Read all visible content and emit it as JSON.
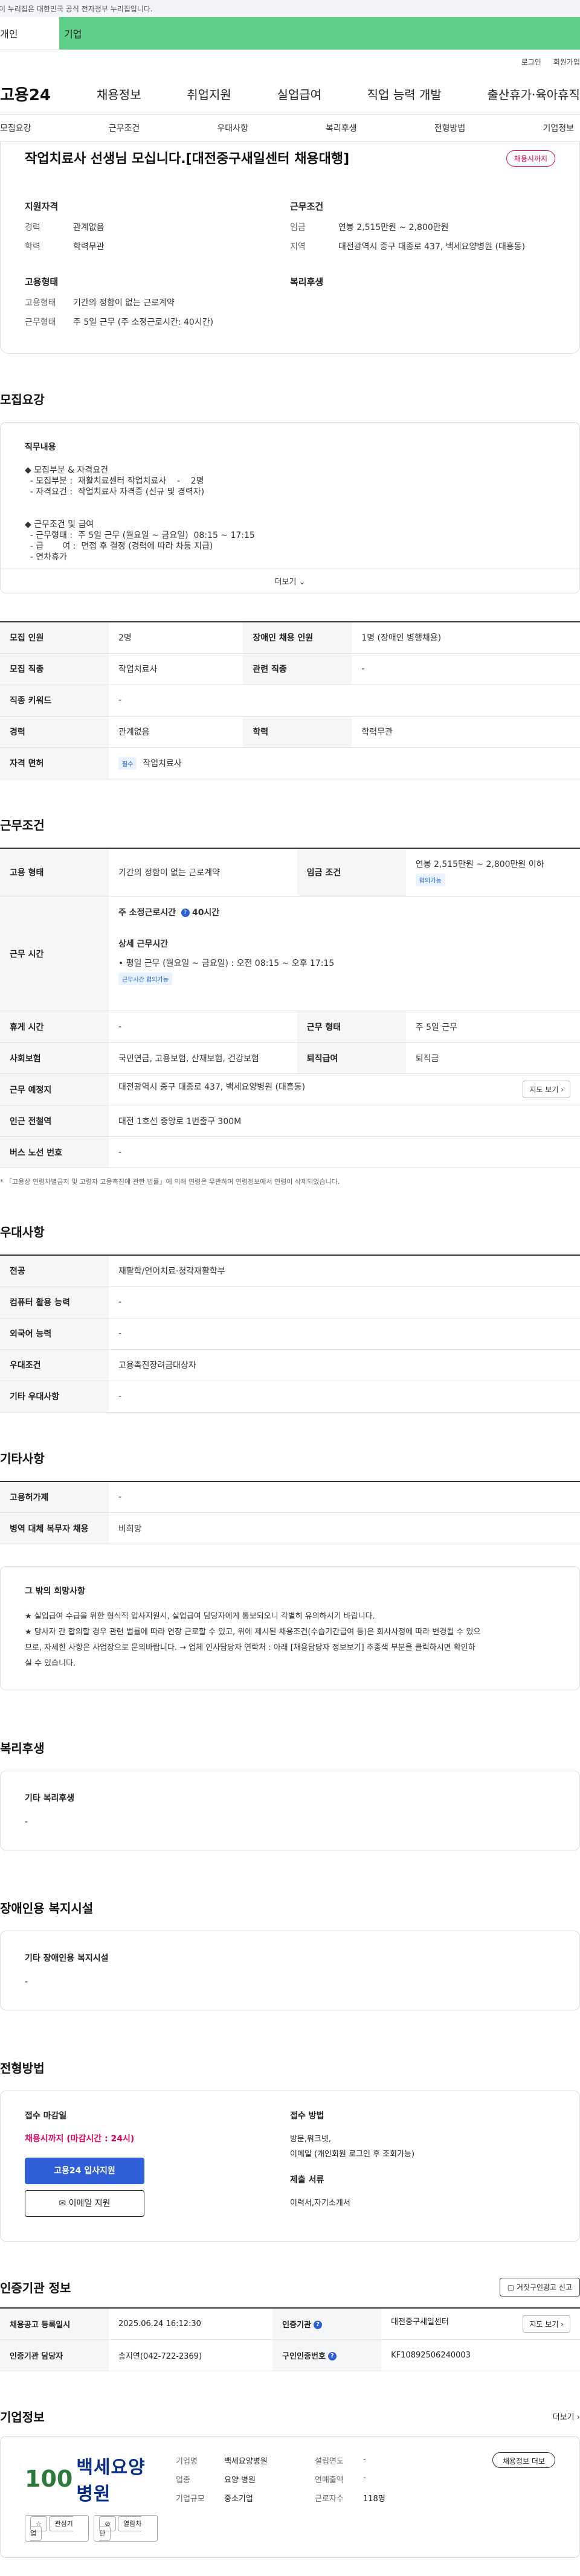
{
  "gov_banner": "이 누리집은 대한민국 공식 전자정부 누리집입니다.",
  "service_tabs": {
    "left": "개인",
    "active": "기업"
  },
  "util_links": [
    "로그인",
    "회원가입"
  ],
  "gnb": {
    "logo": "고용24",
    "menu": [
      "채용정보",
      "취업지원",
      "실업급여",
      "직업 능력 개발",
      "출산휴가·육아휴직"
    ]
  },
  "subnav": [
    "모집요강",
    "근무조건",
    "우대사항",
    "복리후생",
    "전형방법",
    "기업정보"
  ],
  "summary": {
    "title": "작업치료사 선생님 모십니다.[대전중구새일센터 채용대행]",
    "status": "채용시까지",
    "qualification": {
      "heading": "지원자격",
      "career_label": "경력",
      "career_value": "관계없음",
      "edu_label": "학력",
      "edu_value": "학력무관"
    },
    "work": {
      "heading": "근무조건",
      "pay_label": "임금",
      "pay_value": "연봉 2,515만원 ~ 2,800만원",
      "location_label": "지역",
      "location_value": "대전광역시 중구 대종로 437, 백세요양병원 (대흥동)"
    },
    "employment": {
      "heading": "고용형태",
      "type_label": "고용형태",
      "type_value": "기간의 정함이 없는 근로계약",
      "hours_label": "근무형태",
      "hours_value": "주 5일 근무 (주 소정근로시간: 40시간)"
    },
    "welfare": {
      "heading": "복리후생"
    }
  },
  "recruit": {
    "section_title": "모집요강",
    "duty_heading": "직무내용",
    "duty_lines": [
      "◆ 모집부분 & 자격요건",
      "  - 모집부분 :  재활치료센터 작업치료사    -    2명",
      "  - 자격요건 :  작업치료사 자격증 (신규 및 경력자)",
      "",
      "",
      "◆ 근무조건 및 급여",
      "  - 근무형태 :  주 5일 근무 (월요일 ~ 금요일)  08:15 ~ 17:15",
      "  - 급       여 :  면접 후 결정 (경력에 따라 차등 지급)",
      "  - 연차휴가"
    ],
    "more": "더보기",
    "rows": [
      {
        "k1": "모집 인원",
        "v1": "2명",
        "k2": "장애인 채용 인원",
        "v2": "1명 (장애인 병행채용)"
      },
      {
        "k1": "모집 직종",
        "v1": "작업치료사",
        "k2": "관련 직종",
        "v2": "-"
      },
      {
        "k1": "직종 키워드",
        "v1": "-"
      },
      {
        "k1": "경력",
        "v1": "관계없음",
        "k2": "학력",
        "v2": "학력무관"
      }
    ],
    "license_label": "자격 면허",
    "license_tag": "필수",
    "license_value": "작업치료사"
  },
  "conditions": {
    "section_title": "근무조건",
    "type_label": "고용 형태",
    "type_value": "기간의 정함이 없는 근로계약",
    "pay_label": "임금 조건",
    "pay_value": "연봉 2,515만원 ~ 2,800만원 이하",
    "pay_tag": "협의가능",
    "time_label": "근무 시간",
    "time_weekly": "주 소정근로시간",
    "time_weekly_value": "40시간",
    "time_detail_heading": "상세 근무시간",
    "time_detail": "• 평일 근무 (월요일 ~ 금요일) : 오전 08:15 ~ 오후 17:15",
    "time_tag": "근무시간 협의가능",
    "break_label": "휴게 시간",
    "break_value": "-",
    "shift_label": "근무 형태",
    "shift_value": "주 5일 근무",
    "insurance_label": "사회보험",
    "insurance_value": "국민연금, 고용보험, 산재보험, 건강보험",
    "severance_label": "퇴직급여",
    "severance_value": "퇴직금",
    "place_label": "근무 예정지",
    "place_value": "대전광역시 중구 대종로 437, 백세요양병원 (대흥동)",
    "map_btn": "지도 보기",
    "station_label": "인근 전철역",
    "station_value": "대전 1호선 중앙로 1번출구 300M",
    "bus_label": "버스 노선 번호",
    "bus_value": "-",
    "footnote": "* 「고용상 연령차별금지 및 고령자 고용촉진에 관한 법률」에 의해 연령은 무관하며 연령정보에서 연령이 삭제되었습니다."
  },
  "preference": {
    "section_title": "우대사항",
    "rows": [
      {
        "k": "전공",
        "v": "재활학/언어치료·청각재활학부"
      },
      {
        "k": "컴퓨터 활용 능력",
        "v": "-"
      },
      {
        "k": "외국어 능력",
        "v": "-"
      },
      {
        "k": "우대조건",
        "v": "고용촉진장려금대상자"
      },
      {
        "k": "기타 우대사항",
        "v": "-"
      }
    ]
  },
  "etc": {
    "section_title": "기타사항",
    "rows": [
      {
        "k": "고용허가제",
        "v": "-"
      },
      {
        "k": "병역 대체 복무자 채용",
        "v": "비희망"
      }
    ],
    "wish_heading": "그 밖의 희망사항",
    "wish_lines": [
      "★ 실업급여 수급을 위한 형식적 입사지원시, 실업급여 담당자에게 통보되오니 각별히 유의하시기 바랍니다.",
      "★ 당사자 간 합의할 경우 관련 법률에 따라 연장 근로할 수 있고, 위에 제시된 채용조건(수습기간급여 등)은 회사사정에 따라 변경될 수 있으",
      "므로, 자세한 사항은 사업장으로 문의바랍니다. → 업체 인사담당자 연락처 : 아래 [채용담당자 정보보기] 추종색 부분을 클릭하시면 확인하",
      "실 수 있습니다."
    ]
  },
  "welfare": {
    "section_title": "복리후생",
    "heading": "기타 복리후생",
    "value": "-"
  },
  "facility": {
    "section_title": "장애인용 복지시설",
    "heading": "기타 장애인용 복지시설",
    "value": "-"
  },
  "process": {
    "section_title": "전형방법",
    "deadline_heading": "접수 마감일",
    "deadline_value": "채용시까지 (마감시간 : 24시)",
    "apply_btn": "고용24 입사지원",
    "email_btn": "이메일 지원",
    "method_heading": "접수 방법",
    "method_value_1": "방문,워크넷,",
    "method_value_2": "이메일 (개인회원 로그인 후 조회가능)",
    "docs_heading": "제출 서류",
    "docs_value": "이력서,자기소개서"
  },
  "agency": {
    "section_title": "인증기관 정보",
    "report_btn": "거짓구인광고 신고",
    "reg_label": "채용공고 등록일시",
    "reg_value": "2025.06.24 16:12:30",
    "agency_label": "인증기관",
    "agency_value": "대전중구새일센터",
    "map_btn": "지도 보기",
    "manager_label": "인증기관 담당자",
    "manager_value": "송지연(042-722-2369)",
    "job_no_label": "구인인증번호",
    "job_no_value": "KF10892506240003"
  },
  "company": {
    "section_title": "기업정보",
    "more": "더보기",
    "logo_num": "100",
    "logo_text": "백세요양병원",
    "fav_btn": "관심기업",
    "block_btn": "열람차단",
    "name_label": "기업명",
    "name_value": "백세요양병원",
    "founded_label": "설립연도",
    "founded_value": "-",
    "industry_label": "업종",
    "industry_value": "요양 병원",
    "sales_label": "연매출액",
    "sales_value": "-",
    "size_label": "기업규모",
    "size_value": "중소기업",
    "staff_label": "근로자수",
    "staff_value": "118명",
    "detail_btn": "채용정보 더보",
    "colors": {
      "logo_green": "#2b7a3c",
      "logo_blue": "#0a2f8a"
    }
  },
  "colors": {
    "accent": "#5ed08a",
    "primary": "#2f5ed8",
    "alert": "#e0005a"
  }
}
